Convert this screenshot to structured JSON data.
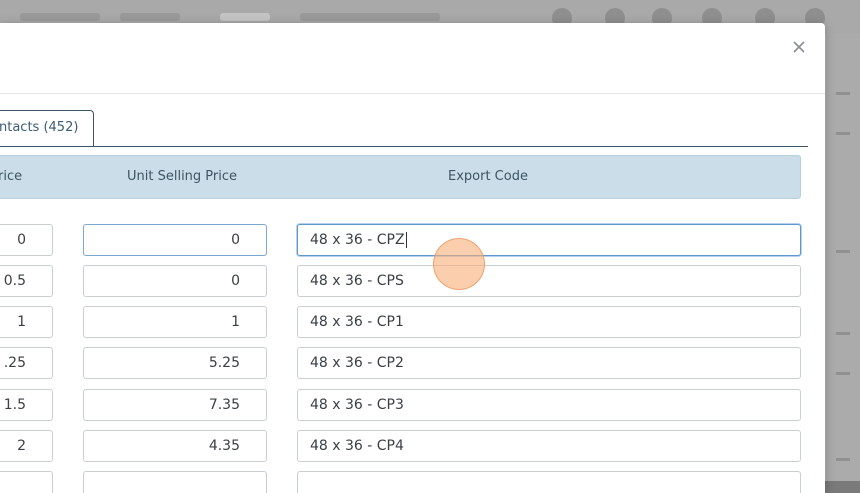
{
  "modal": {
    "tab_label": "ntacts (452)",
    "columns": {
      "price_partial": "rice",
      "unit_selling_price": "Unit Selling Price",
      "export_code": "Export Code"
    },
    "rows": [
      {
        "price": "0",
        "unit_selling_price": "0",
        "export_code": "48 x 36 - CPZ"
      },
      {
        "price": "0.5",
        "unit_selling_price": "0",
        "export_code": "48 x 36 - CPS"
      },
      {
        "price": "1",
        "unit_selling_price": "1",
        "export_code": "48 x 36 - CP1"
      },
      {
        "price": ".25",
        "unit_selling_price": "5.25",
        "export_code": "48 x 36 - CP2"
      },
      {
        "price": "1.5",
        "unit_selling_price": "7.35",
        "export_code": "48 x 36 - CP3"
      },
      {
        "price": "2",
        "unit_selling_price": "4.35",
        "export_code": "48 x 36 - CP4"
      }
    ]
  },
  "colors": {
    "header_bg": "#cbdde8",
    "tab_border": "#3e5566",
    "focus_border": "#5f97cf",
    "touch_indicator": "#f8ad78"
  },
  "icons": {
    "close": "close-icon"
  }
}
